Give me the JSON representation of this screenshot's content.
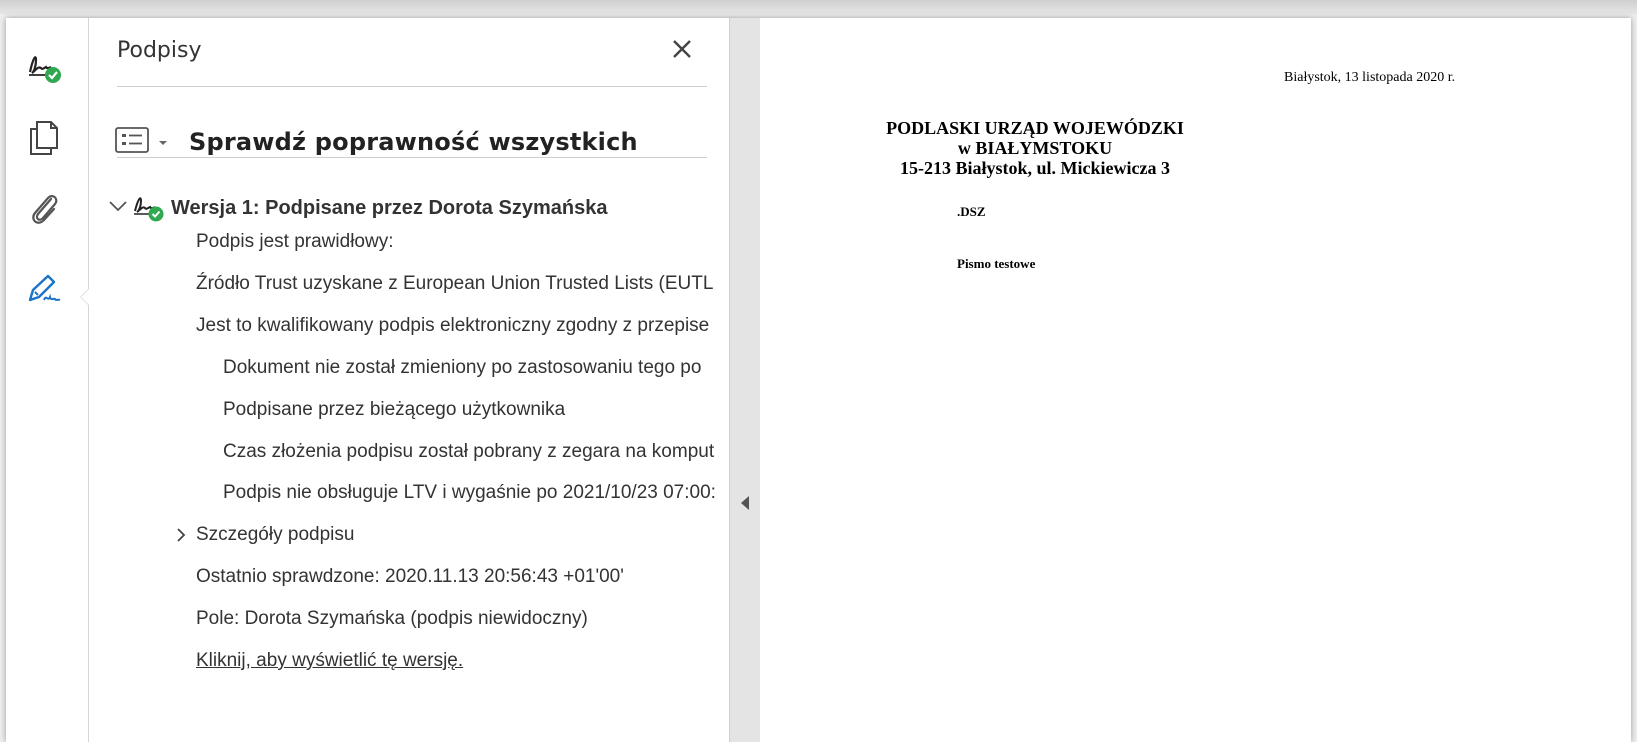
{
  "rail": {
    "items": [
      {
        "icon": "signature-valid-icon"
      },
      {
        "icon": "pages-icon"
      },
      {
        "icon": "attachment-icon"
      },
      {
        "icon": "fill-sign-icon"
      }
    ]
  },
  "panel": {
    "title": "Podpisy",
    "verify_all_label": "Sprawdź poprawność wszystkich",
    "version_label": "Wersja 1: Podpisane przez Dorota Szymańska",
    "valid_line": "Podpis jest prawidłowy:",
    "trust_line": "Źródło Trust uzyskane z European Union Trusted Lists (EUTL",
    "qualified_line": "Jest to kwalifikowany podpis elektroniczny zgodny z przepise",
    "unchanged_line": "Dokument nie został zmieniony po zastosowaniu tego po",
    "signed_by_line": "Podpisane przez bieżącego użytkownika",
    "time_line": "Czas złożenia podpisu został pobrany z zegara na komput",
    "ltv_line": "Podpis nie obsługuje LTV i wygaśnie po 2021/10/23 07:00:",
    "details_label": "Szczegóły podpisu",
    "last_checked": "Ostatnio sprawdzone: 2020.11.13 20:56:43 +01'00'",
    "field_line": "Pole: Dorota Szymańska (podpis niewidoczny)",
    "view_version_link": "Kliknij, aby wyświetlić tę wersję."
  },
  "document": {
    "date": "Białystok, 13 listopada 2020 r.",
    "header_line1": "PODLASKI URZĄD WOJEWÓDZKI",
    "header_line2": "w BIAŁYMSTOKU",
    "header_line3": "15-213 Białystok, ul. Mickiewicza 3",
    "reference": ".DSZ",
    "subject": "Pismo testowe"
  },
  "colors": {
    "valid_green": "#2fa84f",
    "active_blue": "#1a73c8",
    "text": "#333333"
  }
}
